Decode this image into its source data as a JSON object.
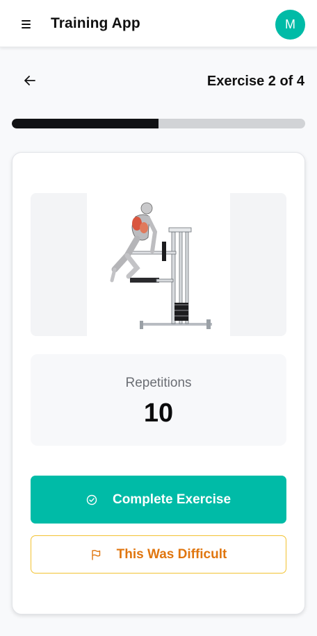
{
  "header": {
    "title": "Training App",
    "avatar_initial": "M",
    "menu_icon": "hamburger-menu-icon"
  },
  "exercise_nav": {
    "back_icon": "arrow-left-icon",
    "counter_text": "Exercise 2 of 4",
    "progress_fraction": 0.5
  },
  "exercise_card": {
    "image_description_icon": "exercise-illustration",
    "reps_label": "Repetitions",
    "reps_value": "10",
    "complete_button_label": "Complete Exercise",
    "complete_icon": "check-circle-icon",
    "difficult_button_label": "This Was Difficult",
    "difficult_icon": "flag-icon"
  },
  "colors": {
    "accent": "#00bba7",
    "warning_text": "#e0760f",
    "warning_border": "#f2c230",
    "progress_fill": "#111214",
    "progress_track": "#d1d3d6"
  }
}
